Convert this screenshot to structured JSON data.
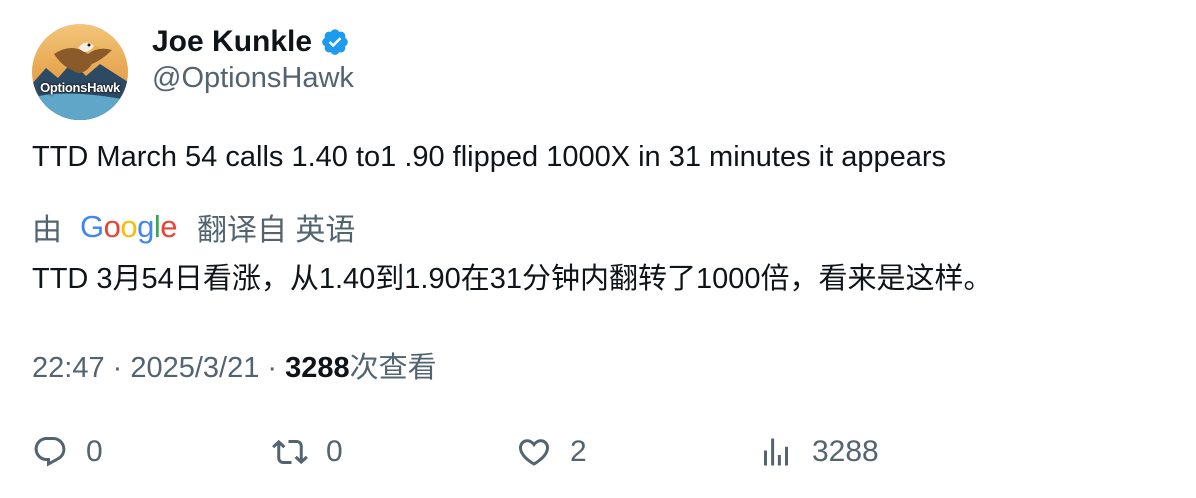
{
  "author": {
    "display_name": "Joe Kunkle",
    "handle": "@OptionsHawk",
    "avatar_text": "OptionsHawk"
  },
  "tweet": {
    "text": "TTD March 54 calls 1.40 to1 .90 flipped 1000X in 31 minutes it appears"
  },
  "translation": {
    "by_label": "由",
    "provider": "Google",
    "provider_letters": [
      "G",
      "o",
      "o",
      "g",
      "l",
      "e"
    ],
    "from_label": "翻译自 英语",
    "text": "TTD 3月54日看涨，从1.40到1.90在31分钟内翻转了1000倍，看来是这样。"
  },
  "meta": {
    "time": "22:47",
    "separator": " · ",
    "date": "2025/3/21",
    "views_count": "3288",
    "views_label": "次查看"
  },
  "actions": {
    "reply_count": "0",
    "retweet_count": "0",
    "like_count": "2",
    "views_count": "3288"
  },
  "colors": {
    "verified": "#1d9bf0",
    "secondary_text": "#536471",
    "primary_text": "#0f1419",
    "google_blue": "#4285F4",
    "google_red": "#EA4335",
    "google_yellow": "#FBBC05",
    "google_green": "#34A853"
  }
}
